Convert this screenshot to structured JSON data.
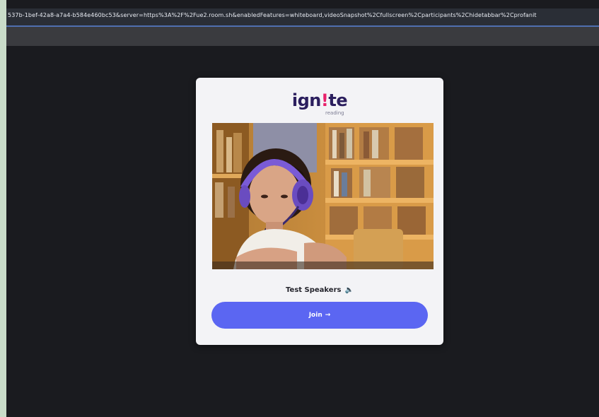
{
  "browser": {
    "url": "537b-1bef-42a8-a7a4-b584e460bc53&server=https%3A%2F%2Fue2.room.sh&enabledFeatures=whiteboard,videoSnapshot%2Cfullscreen%2Cparticipants%2Chidetabbar%2Cprofanit"
  },
  "card": {
    "logo": {
      "prefix": "ign",
      "bang": "!",
      "suffix": "te",
      "sub": "reading"
    },
    "photo_alt": "",
    "test_speakers": {
      "label": "Test Speakers",
      "icon": "speaker-icon",
      "glyph": "🔈"
    },
    "join": {
      "label": "Join",
      "arrow": "→"
    }
  },
  "colors": {
    "stage": "#1a1b1f",
    "card": "#f3f3f6",
    "join_button": "#5b66f2",
    "logo": "#2b1e5e",
    "logo_accent": "#e8206a"
  }
}
